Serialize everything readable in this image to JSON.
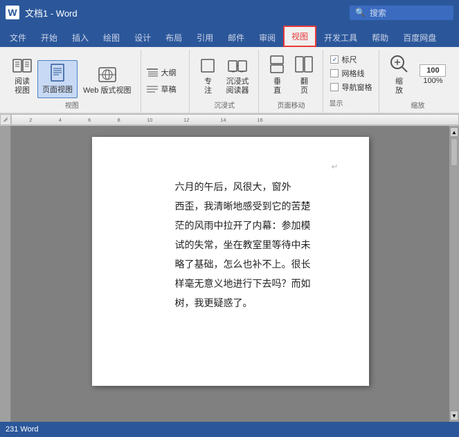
{
  "titlebar": {
    "logo": "W",
    "title": "文档1 - Word",
    "search_placeholder": "搜索"
  },
  "ribbon_tabs": [
    {
      "id": "file",
      "label": "文件",
      "active": false
    },
    {
      "id": "home",
      "label": "开始",
      "active": false
    },
    {
      "id": "insert",
      "label": "插入",
      "active": false
    },
    {
      "id": "draw",
      "label": "绘图",
      "active": false
    },
    {
      "id": "design",
      "label": "设计",
      "active": false
    },
    {
      "id": "layout",
      "label": "布局",
      "active": false
    },
    {
      "id": "references",
      "label": "引用",
      "active": false
    },
    {
      "id": "mailings",
      "label": "邮件",
      "active": false
    },
    {
      "id": "review",
      "label": "审阅",
      "active": false
    },
    {
      "id": "view",
      "label": "视图",
      "active": true,
      "highlighted": true
    },
    {
      "id": "developer",
      "label": "开发工具",
      "active": false
    },
    {
      "id": "help",
      "label": "帮助",
      "active": false
    },
    {
      "id": "baidu",
      "label": "百度网盘",
      "active": false
    }
  ],
  "ribbon": {
    "groups": [
      {
        "id": "view_group",
        "label": "视图",
        "buttons": [
          {
            "id": "read_view",
            "label": "阅读\n视图",
            "icon": "📖"
          },
          {
            "id": "page_view",
            "label": "页面视图",
            "icon": "📄",
            "active": true
          },
          {
            "id": "web_view",
            "label": "Web 版式视图",
            "icon": "🌐"
          }
        ]
      },
      {
        "id": "outline_group",
        "label": "",
        "small_buttons": [
          {
            "id": "outline",
            "label": "大纲",
            "icon": "≡"
          },
          {
            "id": "draft",
            "label": "草稿",
            "icon": "≡"
          }
        ]
      },
      {
        "id": "immersive_group",
        "label": "沉浸式",
        "buttons": [
          {
            "id": "focus",
            "label": "专\n注",
            "icon": "□"
          },
          {
            "id": "immersive_reader",
            "label": "沉浸式\n阅读器",
            "icon": "📖"
          }
        ]
      },
      {
        "id": "pagemove_group",
        "label": "页面移动",
        "buttons": [
          {
            "id": "vertical",
            "label": "垂\n直",
            "icon": "⬜"
          },
          {
            "id": "flip",
            "label": "翻\n页",
            "icon": "⬜"
          }
        ]
      },
      {
        "id": "display_group",
        "label": "显示",
        "checks": [
          {
            "id": "ruler",
            "label": "标尺",
            "checked": true
          },
          {
            "id": "gridlines",
            "label": "网格线",
            "checked": false
          },
          {
            "id": "nav_pane",
            "label": "导航窗格",
            "checked": false
          }
        ]
      },
      {
        "id": "zoom_group",
        "label": "缩放",
        "buttons": [
          {
            "id": "zoom",
            "label": "缩\n放",
            "icon": "🔍"
          },
          {
            "id": "zoom_pct",
            "label": "100%",
            "icon": ""
          }
        ]
      }
    ]
  },
  "document": {
    "text_lines": [
      "六月的午后，风很大，窗外",
      "西歪，我清晰地感受到它的苦楚",
      "茫的风雨中拉开了内幕：参加模",
      "试的失常，坐在教室里等待中未",
      "略了基础，怎么也补不上。很长",
      "样毫无意义地进行下去吗？而如",
      "树，我更疑惑了。"
    ]
  },
  "statusbar": {
    "word_count": "231 Word"
  }
}
